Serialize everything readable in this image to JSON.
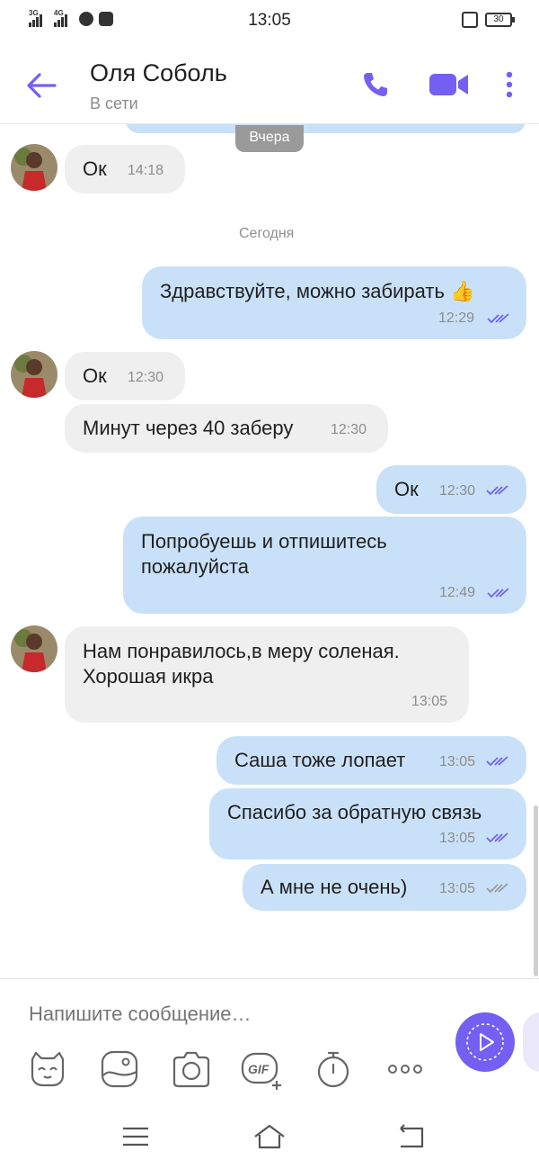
{
  "status_bar": {
    "time": "13:05",
    "net1": "3G",
    "net2": "4G",
    "battery": "30"
  },
  "header": {
    "name": "Оля Соболь",
    "status": "В сети"
  },
  "colors": {
    "accent": "#7360f2",
    "outgoing_bubble": "#c9e1f8",
    "incoming_bubble": "#efefef"
  },
  "dates": {
    "yesterday": "Вчера",
    "today": "Сегодня"
  },
  "messages": [
    {
      "dir": "in",
      "text": "Ок",
      "time": "14:18"
    },
    {
      "dir": "out",
      "text": "Здравствуйте, можно забирать 👍",
      "time": "12:29"
    },
    {
      "dir": "in",
      "text": "Ок",
      "time": "12:30"
    },
    {
      "dir": "in",
      "text": "Минут через 40 заберу",
      "time": "12:30"
    },
    {
      "dir": "out",
      "text": "Ок",
      "time": "12:30"
    },
    {
      "dir": "out",
      "text": "Попробуешь и отпишитесь\nпожалуйста",
      "time": "12:49"
    },
    {
      "dir": "in",
      "text": "Нам понравилось,в меру соленая.\nХорошая икра",
      "time": "13:05"
    },
    {
      "dir": "out",
      "text": "Саша тоже лопает",
      "time": "13:05"
    },
    {
      "dir": "out",
      "text": "Спасибо за обратную связь",
      "time": "13:05"
    },
    {
      "dir": "out",
      "text": "А мне не очень)",
      "time": "13:05"
    }
  ],
  "composer": {
    "placeholder": "Напишите сообщение…",
    "tools": [
      "sticker-icon",
      "gallery-icon",
      "camera-icon",
      "gif-icon",
      "timer-icon",
      "more-icon"
    ]
  }
}
